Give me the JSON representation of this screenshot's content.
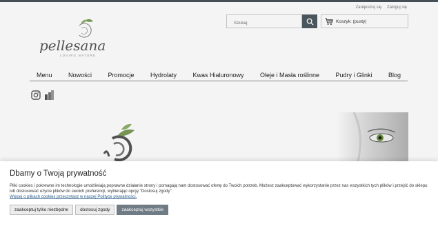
{
  "header": {
    "register_label": "Zarejestruj się",
    "login_label": "Zaloguj się",
    "search_placeholder": "Szukaj",
    "cart_label": "Koszyk: (pusty)"
  },
  "logo": {
    "name": "pellesana",
    "tagline": "LOVING NATURE"
  },
  "nav": {
    "items": [
      "Menu",
      "Nowości",
      "Promocje",
      "Hydrolaty",
      "Kwas Hialuronowy",
      "Oleje i Masła roślinne",
      "Pudry i Glinki",
      "Blog"
    ]
  },
  "cookie": {
    "title": "Dbamy o Twoją prywatność",
    "text": "Pliki cookies i pokrewne im technologie umożliwiają poprawne działanie strony i pomagają nam dostosować ofertę do Twoich potrzeb. Możesz zaakceptować wykorzystanie przez nas wszystkich tych plików i przejść do sklepu lub dostosować użycie plików do swoich preferencji, wybierając opcję \"Dostosuj zgody\".",
    "link": "Więcej o plikach cookies przeczytasz w naszej Polityce prywatności.",
    "btn_necessary": "zaakceptuj tylko niezbędne",
    "btn_customize": "dostosuj zgody",
    "btn_accept_all": "zaakceptuj wszystkie"
  },
  "colors": {
    "accent": "#6f7b85",
    "search_button": "#4e5a63",
    "logo_green": "#7a9b58"
  }
}
